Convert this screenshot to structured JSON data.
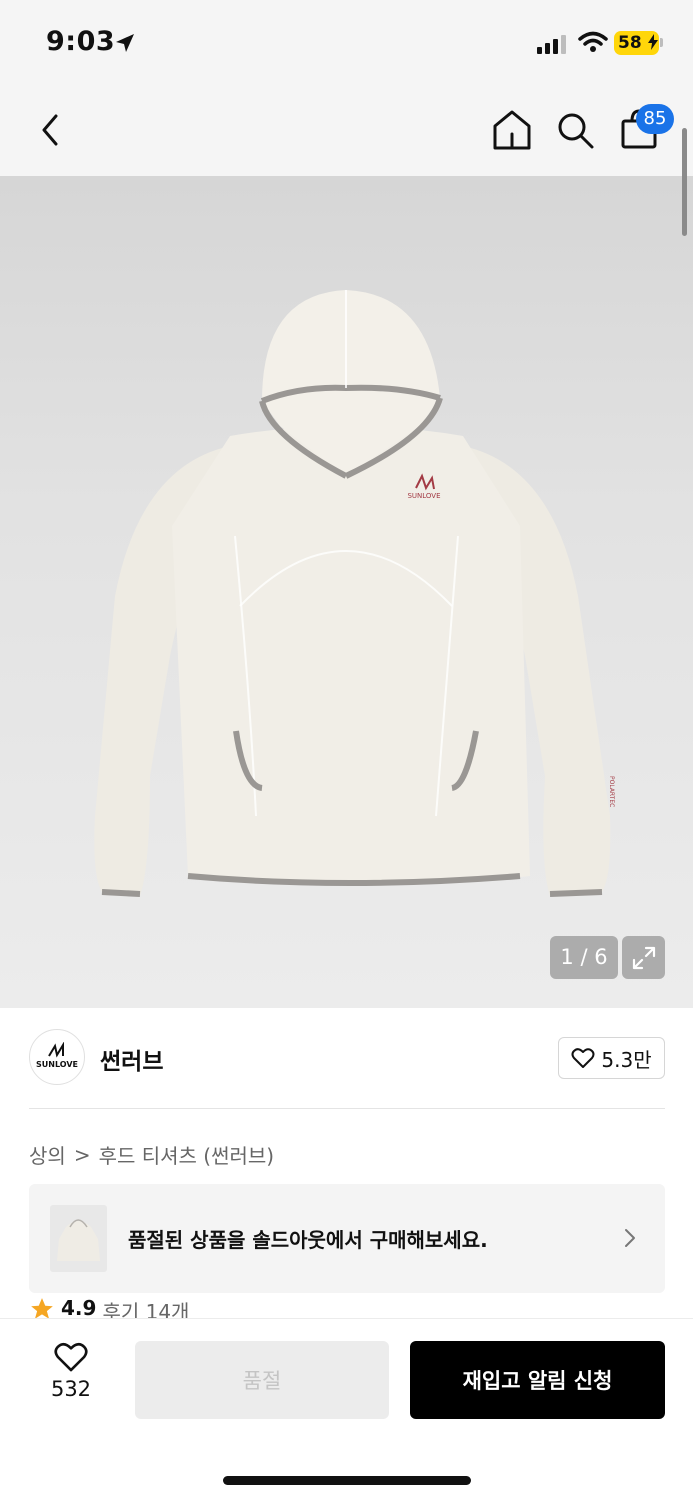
{
  "status_bar": {
    "time": "9:03",
    "battery": "58"
  },
  "nav": {
    "cart_count": "85"
  },
  "product_image": {
    "counter": "1 / 6",
    "print_logo": "SUNLOVE",
    "sleeve_label": "POLARTEC"
  },
  "brand": {
    "logo_text": "SUNLOVE",
    "name": "썬러브",
    "like_count": "5.3만"
  },
  "breadcrumb": {
    "category": "상의",
    "separator": ">",
    "subcategory": "후드 티셔츠 (썬러브)"
  },
  "soldout_banner": {
    "text": "품절된 상품을 솔드아웃에서 구매해보세요."
  },
  "rating": {
    "score": "4.9",
    "reviews": "후기 14개"
  },
  "bottom_bar": {
    "wish_count": "532",
    "soldout_label": "품절",
    "restock_label": "재입고 알림 신청"
  },
  "colors": {
    "accent_blue": "#1a73e8",
    "star": "#f5a623",
    "battery": "#ffd60a",
    "primary_button": "#000000"
  }
}
